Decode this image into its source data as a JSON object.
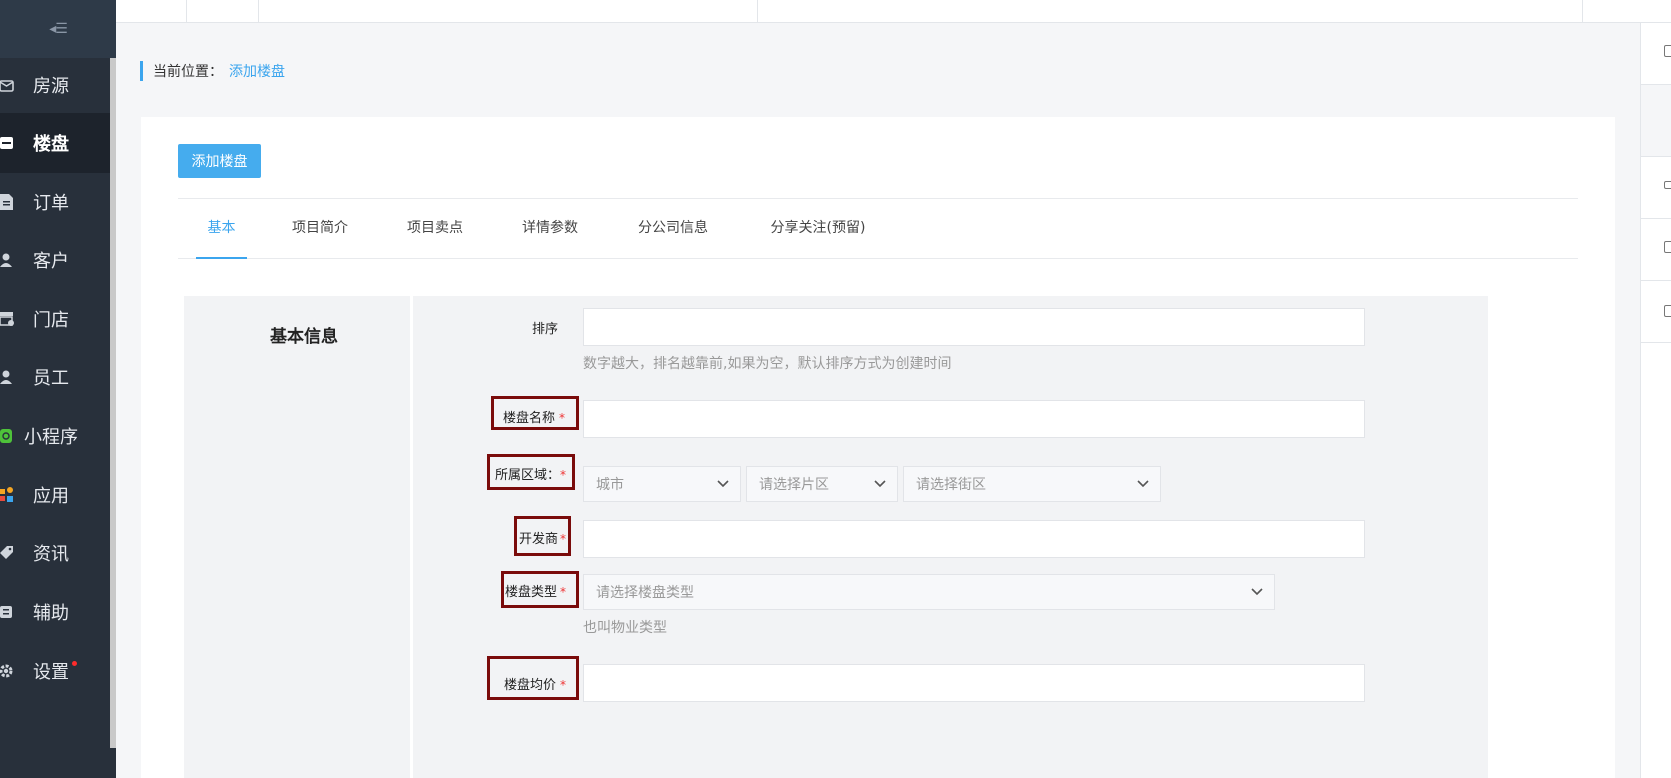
{
  "sidebar": {
    "collapse_glyph": "◂☰",
    "items": [
      {
        "label": "房源",
        "icon": "house-icon"
      },
      {
        "label": "楼盘",
        "icon": "building-icon"
      },
      {
        "label": "订单",
        "icon": "document-icon"
      },
      {
        "label": "客户",
        "icon": "user-icon"
      },
      {
        "label": "门店",
        "icon": "store-icon"
      },
      {
        "label": "员工",
        "icon": "user-icon"
      },
      {
        "label": "小程序",
        "icon": "miniprogram-icon"
      },
      {
        "label": "应用",
        "icon": "apps-icon"
      },
      {
        "label": "资讯",
        "icon": "tag-icon"
      },
      {
        "label": "辅助",
        "icon": "helper-icon"
      },
      {
        "label": "设置",
        "icon": "gear-icon"
      }
    ],
    "active_index": 1
  },
  "breadcrumb": {
    "prefix": "当前位置：",
    "current": "添加楼盘"
  },
  "toolbar": {
    "add_label": "添加楼盘"
  },
  "tabs": [
    {
      "label": "基本"
    },
    {
      "label": "项目简介"
    },
    {
      "label": "项目卖点"
    },
    {
      "label": "详情参数"
    },
    {
      "label": "分公司信息"
    },
    {
      "label": "分享关注(预留)"
    }
  ],
  "form": {
    "section_title": "基本信息",
    "sort": {
      "label": "排序",
      "value": "",
      "hint": "数字越大，排名越靠前,如果为空，默认排序方式为创建时间"
    },
    "name": {
      "label": "楼盘名称",
      "required": "*",
      "value": ""
    },
    "region": {
      "label": "所属区域：",
      "required": "*",
      "city": "城市",
      "district": "请选择片区",
      "street": "请选择街区"
    },
    "developer": {
      "label": "开发商",
      "required": "*",
      "value": ""
    },
    "type": {
      "label": "楼盘类型",
      "required": "*",
      "placeholder": "请选择楼盘类型",
      "hint": "也叫物业类型"
    },
    "avg_price": {
      "label": "楼盘均价",
      "required": "*",
      "value": ""
    }
  },
  "colors": {
    "sidebar_bg": "#28303b",
    "accent": "#3ba5ee",
    "annotation_box": "#7a0b0b",
    "required": "#ee3333"
  }
}
